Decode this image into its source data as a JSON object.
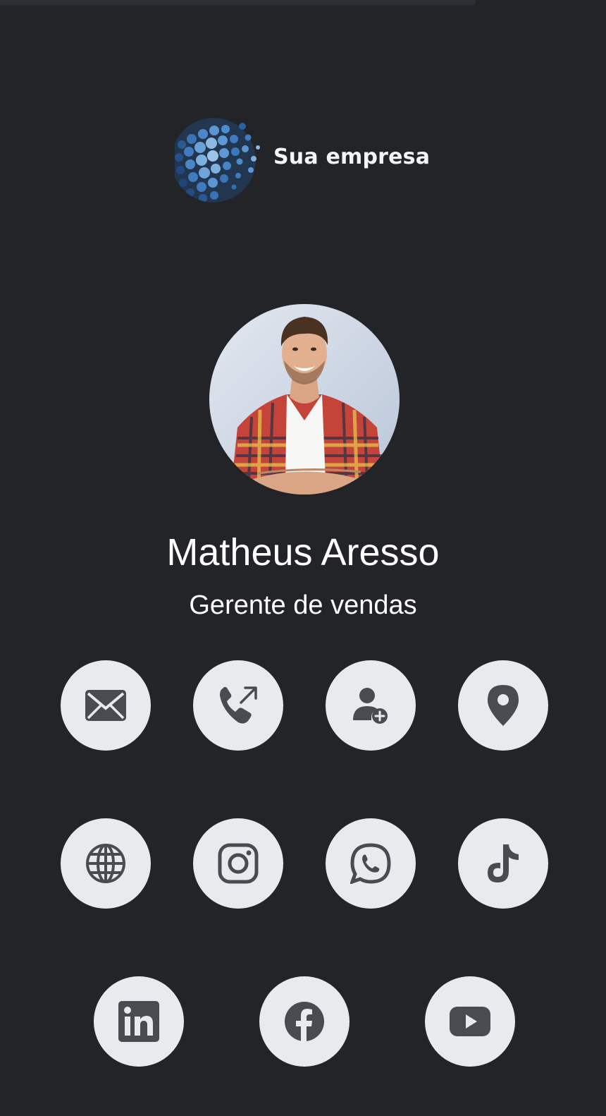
{
  "company": {
    "name": "Sua empresa",
    "logo_icon": "globe-hexagon-logo",
    "logo_colors": [
      "#2f6fb6",
      "#4c8fd0",
      "#7fb0dd",
      "#1f4f86"
    ]
  },
  "profile": {
    "name": "Matheus Aresso",
    "title": "Gerente de vendas",
    "photo": "avatar-photo"
  },
  "theme": {
    "background": "#222428",
    "button_bg": "#e9eaee",
    "icon_color": "#4a4b50",
    "text": "#ffffff"
  },
  "actions": [
    {
      "icon": "email-icon"
    },
    {
      "icon": "phone-call-icon"
    },
    {
      "icon": "add-contact-icon"
    },
    {
      "icon": "location-pin-icon"
    },
    {
      "icon": "website-globe-icon"
    },
    {
      "icon": "instagram-icon"
    },
    {
      "icon": "whatsapp-icon"
    },
    {
      "icon": "tiktok-icon"
    },
    {
      "icon": "linkedin-icon"
    },
    {
      "icon": "facebook-icon"
    },
    {
      "icon": "youtube-icon"
    }
  ]
}
